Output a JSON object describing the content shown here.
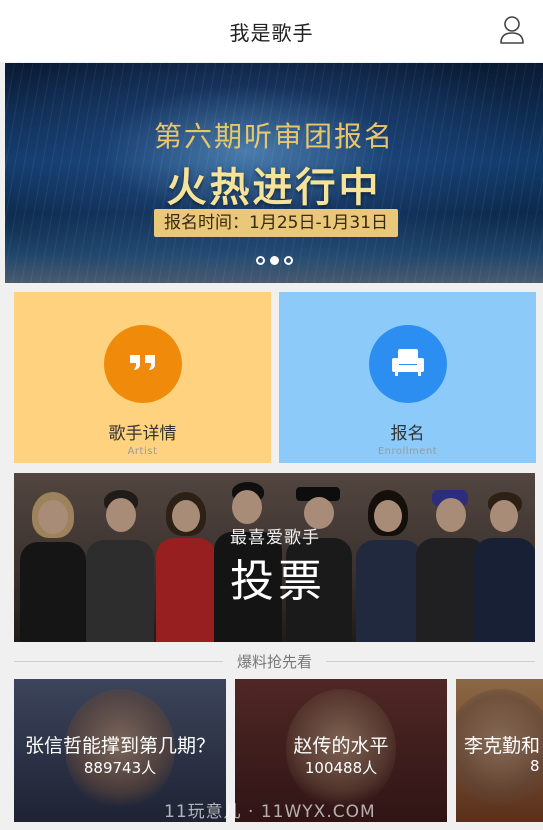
{
  "header": {
    "title": "我是歌手"
  },
  "banner": {
    "line1": "第六期听审团报名",
    "line2": "火热进行中",
    "date": "报名时间：1月25日-1月31日",
    "dots": 3,
    "active_dot": 1
  },
  "cards": [
    {
      "title": "歌手详情",
      "subtitle": "Artist"
    },
    {
      "title": "报名",
      "subtitle": "Enrollment"
    }
  ],
  "vote": {
    "small": "最喜爱歌手",
    "big": "投票"
  },
  "section": {
    "title": "爆料抢先看"
  },
  "news": [
    {
      "title": "张信哲能撑到第几期？",
      "count": "889743人"
    },
    {
      "title": "赵传的水平",
      "count": "100488人"
    },
    {
      "title": "李克勤和",
      "count": "8"
    }
  ],
  "watermark": "11玩意儿 · 11WYX.COM"
}
